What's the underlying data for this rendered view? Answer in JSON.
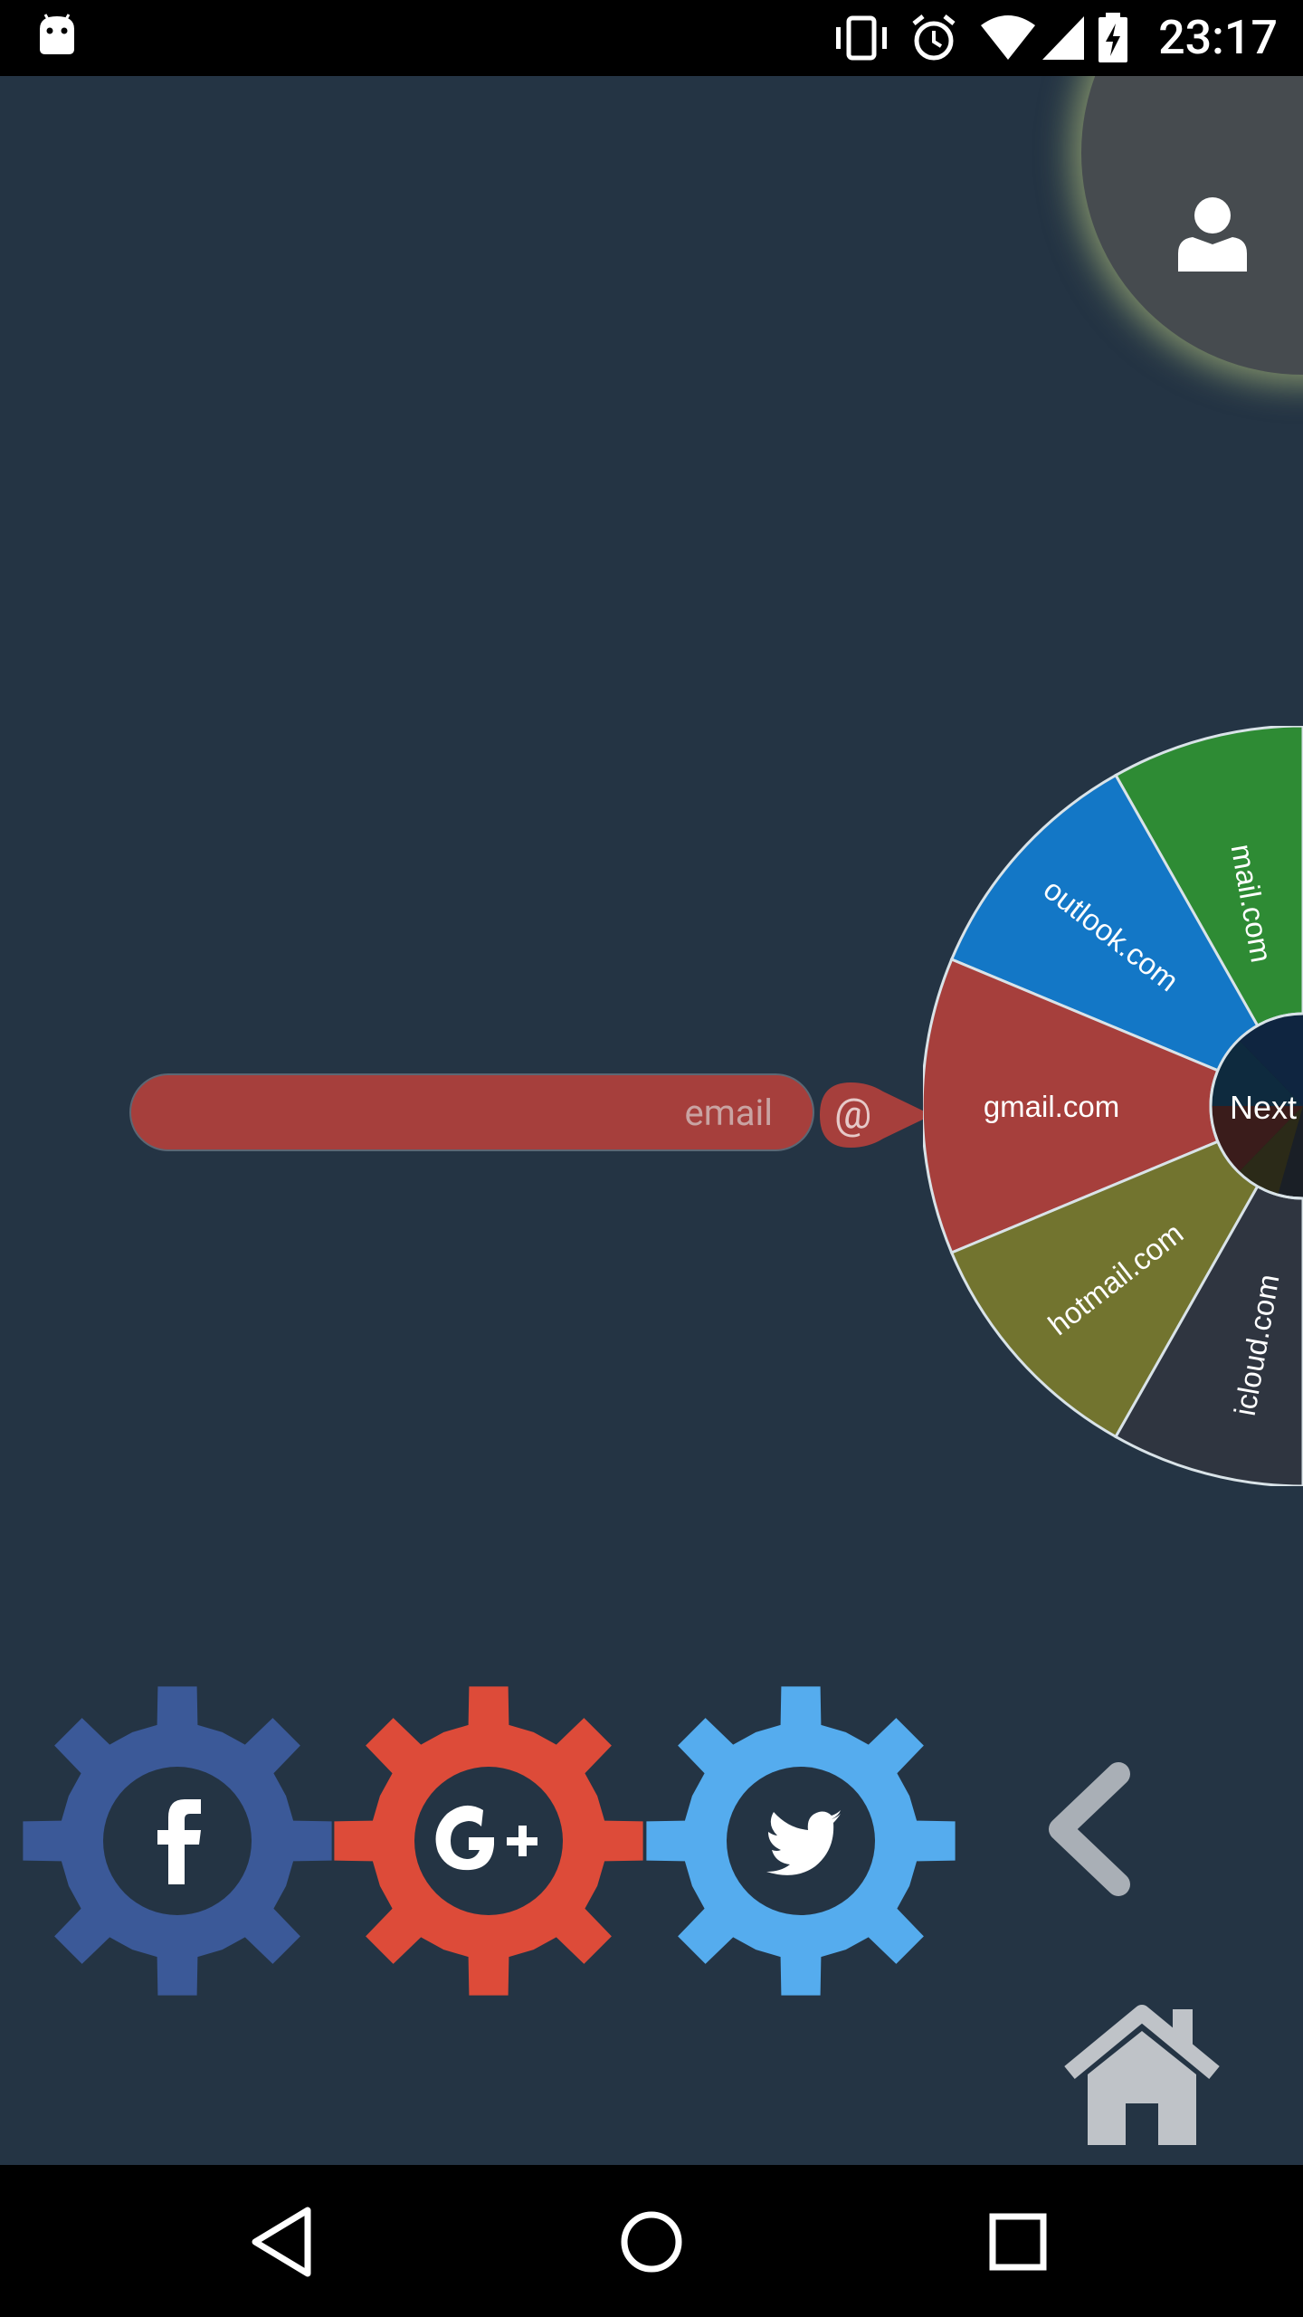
{
  "status_bar": {
    "time": "23:17",
    "icons": [
      "android-debug-icon",
      "vibrate-icon",
      "alarm-icon",
      "wifi-icon",
      "cell-signal-icon",
      "battery-charging-icon"
    ]
  },
  "profile": {
    "icon": "person-icon",
    "glow_color": "#d6e48c"
  },
  "email": {
    "placeholder": "email",
    "value": "",
    "at_symbol": "@"
  },
  "domain_wheel": {
    "center_label": "Next",
    "slices": [
      {
        "label": "mail.com",
        "color": "#2e8b34"
      },
      {
        "label": "outlook.com",
        "color": "#1377c6"
      },
      {
        "label": "gmail.com",
        "color": "#a63f3c"
      },
      {
        "label": "hotmail.com",
        "color": "#72742f"
      },
      {
        "label": "icloud.com",
        "color": "#2f3540"
      }
    ]
  },
  "social": [
    {
      "name": "facebook",
      "icon": "facebook-icon",
      "color": "#3b5998"
    },
    {
      "name": "google-plus",
      "icon": "google-plus-icon",
      "color": "#dd4b39"
    },
    {
      "name": "twitter",
      "icon": "twitter-icon",
      "color": "#55acee"
    }
  ],
  "navigation": {
    "back_icon": "chevron-left-icon",
    "home_icon": "home-icon"
  },
  "system_nav": {
    "buttons": [
      "back-triangle-icon",
      "home-circle-icon",
      "recents-square-icon"
    ]
  }
}
